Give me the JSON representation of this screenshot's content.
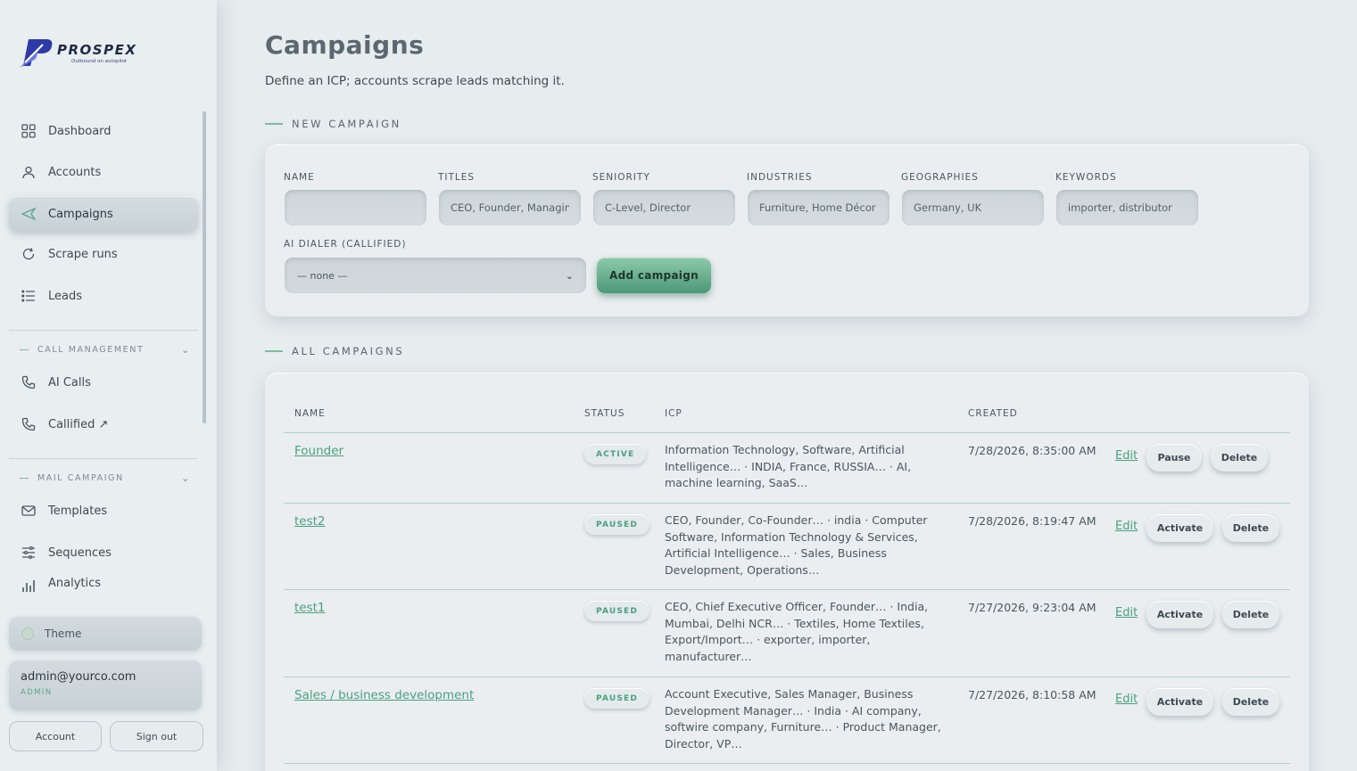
{
  "brand": {
    "name": "PROSPEX",
    "tagline": "Outbound on autopilot"
  },
  "sidebar": {
    "items": [
      {
        "label": "Dashboard",
        "icon": "grid-icon"
      },
      {
        "label": "Accounts",
        "icon": "user-icon"
      },
      {
        "label": "Campaigns",
        "icon": "send-icon",
        "active": true
      },
      {
        "label": "Scrape runs",
        "icon": "refresh-icon"
      },
      {
        "label": "Leads",
        "icon": "list-icon"
      }
    ],
    "call_section": {
      "title": "CALL MANAGEMENT",
      "items": [
        {
          "label": "AI Calls",
          "icon": "phone-icon"
        },
        {
          "label": "Callified ↗",
          "icon": "phone-icon"
        }
      ]
    },
    "mail_section": {
      "title": "MAIL CAMPAIGN",
      "items": [
        {
          "label": "Templates",
          "icon": "mail-icon"
        },
        {
          "label": "Sequences",
          "icon": "sliders-icon"
        },
        {
          "label": "Analytics",
          "icon": "bar-chart-icon"
        }
      ]
    },
    "theme_label": "Theme",
    "user": {
      "email": "admin@yourco.com",
      "role": "ADMIN"
    },
    "account_button": "Account",
    "signout_button": "Sign out"
  },
  "page": {
    "title": "Campaigns",
    "subtitle": "Define an ICP; accounts scrape leads matching it."
  },
  "new_campaign": {
    "section_title": "NEW CAMPAIGN",
    "fields": {
      "name": {
        "label": "NAME",
        "placeholder": ""
      },
      "titles": {
        "label": "TITLES",
        "placeholder": "CEO, Founder, Managing"
      },
      "seniority": {
        "label": "SENIORITY",
        "placeholder": "C-Level, Director"
      },
      "industries": {
        "label": "INDUSTRIES",
        "placeholder": "Furniture, Home Décor"
      },
      "geographies": {
        "label": "GEOGRAPHIES",
        "placeholder": "Germany, UK"
      },
      "keywords": {
        "label": "KEYWORDS",
        "placeholder": "importer, distributor"
      }
    },
    "dialer": {
      "label": "AI DIALER (CALLIFIED)",
      "selected": "— none —"
    },
    "add_button": "Add campaign"
  },
  "all_campaigns": {
    "section_title": "ALL CAMPAIGNS",
    "columns": [
      "NAME",
      "STATUS",
      "ICP",
      "CREATED"
    ],
    "rows": [
      {
        "name": "Founder",
        "status": "ACTIVE",
        "icp": "Information Technology, Software, Artificial Intelligence… · INDIA, France, RUSSIA… · AI, machine learning, SaaS…",
        "created": "7/28/2026, 8:35:00 AM",
        "edit": "Edit",
        "toggle": "Pause",
        "delete": "Delete"
      },
      {
        "name": "test2",
        "status": "PAUSED",
        "icp": "CEO, Founder, Co-Founder… · india · Computer Software, Information Technology & Services, Artificial Intelligence… · Sales, Business Development, Operations…",
        "created": "7/28/2026, 8:19:47 AM",
        "edit": "Edit",
        "toggle": "Activate",
        "delete": "Delete"
      },
      {
        "name": "test1",
        "status": "PAUSED",
        "icp": "CEO, Chief Executive Officer, Founder… · India, Mumbai, Delhi NCR… · Textiles, Home Textiles, Export/Import… · exporter, importer, manufacturer…",
        "created": "7/27/2026, 9:23:04 AM",
        "edit": "Edit",
        "toggle": "Activate",
        "delete": "Delete"
      },
      {
        "name": "Sales / business development",
        "status": "PAUSED",
        "icp": "Account Executive, Sales Manager, Business Development Manager… · India · AI company, softwire company, Furniture… · Product Manager, Director, VP…",
        "created": "7/27/2026, 8:10:58 AM",
        "edit": "Edit",
        "toggle": "Activate",
        "delete": "Delete"
      }
    ]
  },
  "colors": {
    "accent": "#4aa07f",
    "brand": "#2d3aa8",
    "background": "#e7ecee"
  }
}
